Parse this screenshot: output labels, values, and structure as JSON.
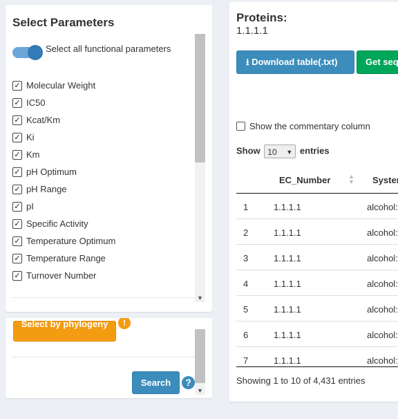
{
  "params": {
    "title": "Select Parameters",
    "toggle_label": "Select all functional parameters",
    "items": [
      {
        "label": "Molecular Weight",
        "checked": true
      },
      {
        "label": "IC50",
        "checked": true
      },
      {
        "label": "Kcat/Km",
        "checked": true
      },
      {
        "label": "Ki",
        "checked": true
      },
      {
        "label": "Km",
        "checked": true
      },
      {
        "label": "pH Optimum",
        "checked": true
      },
      {
        "label": "pH Range",
        "checked": true
      },
      {
        "label": "pI",
        "checked": true
      },
      {
        "label": "Specific Activity",
        "checked": true
      },
      {
        "label": "Temperature Optimum",
        "checked": true
      },
      {
        "label": "Temperature Range",
        "checked": true
      },
      {
        "label": "Turnover Number",
        "checked": true
      }
    ]
  },
  "phylogeny": {
    "button_label": "Select by phylogeny",
    "info_icon": "!",
    "search_label": "Search",
    "help_icon": "?"
  },
  "proteins": {
    "title": "Proteins:",
    "subtitle": "1.1.1.1",
    "download_label": "Download table(.txt)",
    "get_seq_label": "Get sequences",
    "commentary_label": "Show the commentary column",
    "show_label": "Show",
    "entries_value": "10",
    "entries_label": "entries",
    "columns": [
      "EC_Number",
      "Systematic_Name"
    ],
    "rows": [
      {
        "n": "1",
        "ec": "1.1.1.1",
        "sys": "alcohol:NAD+ oxidoreductase"
      },
      {
        "n": "2",
        "ec": "1.1.1.1",
        "sys": "alcohol:NAD+ oxidoreductase"
      },
      {
        "n": "3",
        "ec": "1.1.1.1",
        "sys": "alcohol:NAD+ oxidoreductase"
      },
      {
        "n": "4",
        "ec": "1.1.1.1",
        "sys": "alcohol:NAD+ oxidoreductase"
      },
      {
        "n": "5",
        "ec": "1.1.1.1",
        "sys": "alcohol:NAD+ oxidoreductase"
      },
      {
        "n": "6",
        "ec": "1.1.1.1",
        "sys": "alcohol:NAD+ oxidoreductase"
      },
      {
        "n": "7",
        "ec": "1.1.1.1",
        "sys": "alcohol:NAD+ oxidoreductase"
      }
    ],
    "info": "Showing 1 to 10 of 4,431 entries"
  },
  "colors": {
    "primary": "#3c8dbc",
    "success": "#00a65a",
    "warning": "#f39c12",
    "background": "#ecf0f5"
  }
}
